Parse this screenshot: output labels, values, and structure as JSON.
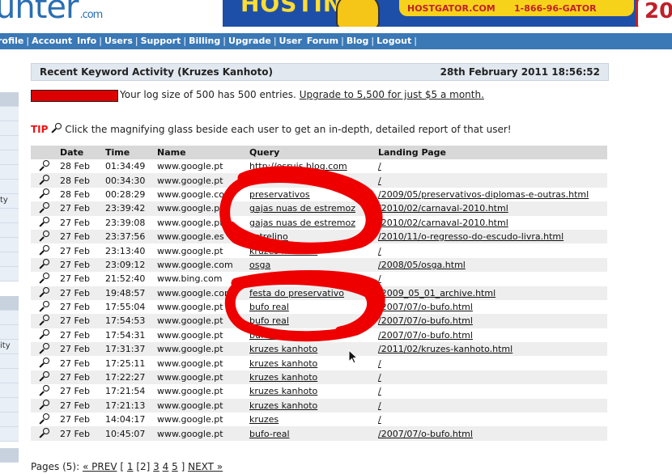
{
  "header": {
    "logo_text": "unter",
    "logo_suffix": ".com",
    "banner": {
      "headline": "HOSTING",
      "site": "HOSTGATOR.COM",
      "phone": "1-866-96-GATOR",
      "badge": "20"
    }
  },
  "nav": {
    "items": [
      "rofile",
      "Account Info",
      "Users",
      "Support",
      "Billing",
      "Upgrade",
      "User Forum",
      "Blog",
      "Logout"
    ]
  },
  "sidebar": {
    "fragments": [
      "ty",
      "ity"
    ]
  },
  "panel": {
    "title": "Recent Keyword Activity (Kruzes Kanhoto)",
    "date": "28th February 2011 18:56:52"
  },
  "log": {
    "fill_percent": 100,
    "text": "Your log size of 500 has 500 entries.",
    "upgrade_link": "Upgrade to 5,500 for just $5 a month."
  },
  "tip": {
    "label": "TIP",
    "text": "Click the magnifying glass beside each user to get an in-depth, detailed report of that user!"
  },
  "table": {
    "headers": [
      "Date",
      "Time",
      "Name",
      "Query",
      "Landing Page"
    ],
    "rows": [
      {
        "date": "28 Feb",
        "time": "01:34:49",
        "name": "www.google.pt",
        "query": "http://osruis.blog.com",
        "landing": "/"
      },
      {
        "date": "28 Feb",
        "time": "00:34:30",
        "name": "www.google.pt",
        "query": "",
        "landing": "/"
      },
      {
        "date": "28 Feb",
        "time": "00:28:29",
        "name": "www.google.com",
        "query": "preservativos",
        "landing": "/2009/05/preservativos-diplomas-e-outras.html"
      },
      {
        "date": "27 Feb",
        "time": "23:39:42",
        "name": "www.google.pt",
        "query": "gajas nuas de estremoz",
        "landing": "/2010/02/carnaval-2010.html"
      },
      {
        "date": "27 Feb",
        "time": "23:39:08",
        "name": "www.google.pt",
        "query": "gajas nuas de estremoz",
        "landing": "/2010/02/carnaval-2010.html"
      },
      {
        "date": "27 Feb",
        "time": "23:37:56",
        "name": "www.google.es",
        "query": "estrelino",
        "landing": "/2010/11/o-regresso-do-escudo-livra.html"
      },
      {
        "date": "27 Feb",
        "time": "23:13:40",
        "name": "www.google.pt",
        "query": "kruzes kanhoto",
        "landing": "/"
      },
      {
        "date": "27 Feb",
        "time": "23:09:12",
        "name": "www.google.com",
        "query": "osga",
        "landing": "/2008/05/osga.html"
      },
      {
        "date": "27 Feb",
        "time": "21:52:40",
        "name": "www.bing.com",
        "query": "blog kruzes kanhoto",
        "landing": "/"
      },
      {
        "date": "27 Feb",
        "time": "19:48:57",
        "name": "www.google.com",
        "query": "festa do preservativo",
        "landing": "/2009_05_01_archive.html"
      },
      {
        "date": "27 Feb",
        "time": "17:55:04",
        "name": "www.google.pt",
        "query": "bufo real",
        "landing": "/2007/07/o-bufo.html"
      },
      {
        "date": "27 Feb",
        "time": "17:54:53",
        "name": "www.google.pt",
        "query": "bufo real",
        "landing": "/2007/07/o-bufo.html"
      },
      {
        "date": "27 Feb",
        "time": "17:54:31",
        "name": "www.google.pt",
        "query": "bufo real",
        "landing": "/2007/07/o-bufo.html"
      },
      {
        "date": "27 Feb",
        "time": "17:31:37",
        "name": "www.google.pt",
        "query": "kruzes kanhoto",
        "landing": "/2011/02/kruzes-kanhoto.html"
      },
      {
        "date": "27 Feb",
        "time": "17:25:11",
        "name": "www.google.pt",
        "query": "kruzes kanhoto",
        "landing": "/"
      },
      {
        "date": "27 Feb",
        "time": "17:22:27",
        "name": "www.google.pt",
        "query": "kruzes kanhoto",
        "landing": "/"
      },
      {
        "date": "27 Feb",
        "time": "17:21:54",
        "name": "www.google.pt",
        "query": "kruzes kanhoto",
        "landing": "/"
      },
      {
        "date": "27 Feb",
        "time": "17:21:13",
        "name": "www.google.pt",
        "query": "kruzes kanhoto",
        "landing": "/"
      },
      {
        "date": "27 Feb",
        "time": "14:04:17",
        "name": "www.google.pt",
        "query": "kruzes",
        "landing": "/"
      },
      {
        "date": "27 Feb",
        "time": "10:45:07",
        "name": "www.google.pt",
        "query": "bufo-real",
        "landing": "/2007/07/o-bufo.html"
      }
    ]
  },
  "pagination": {
    "label": "Pages (5):",
    "prev": "« PREV",
    "open_bracket": "[",
    "pages": [
      "1",
      "[2]",
      "3",
      "4",
      "5"
    ],
    "close_bracket": "]",
    "next": "NEXT »"
  },
  "colors": {
    "nav_bg": "#3a78b6",
    "title_bg": "#e2e8f0",
    "log_bar": "#dd0000",
    "tip_label": "#ee1111",
    "annotation": "#ee0000"
  },
  "icons": {
    "row_action": "magnifier-icon"
  }
}
